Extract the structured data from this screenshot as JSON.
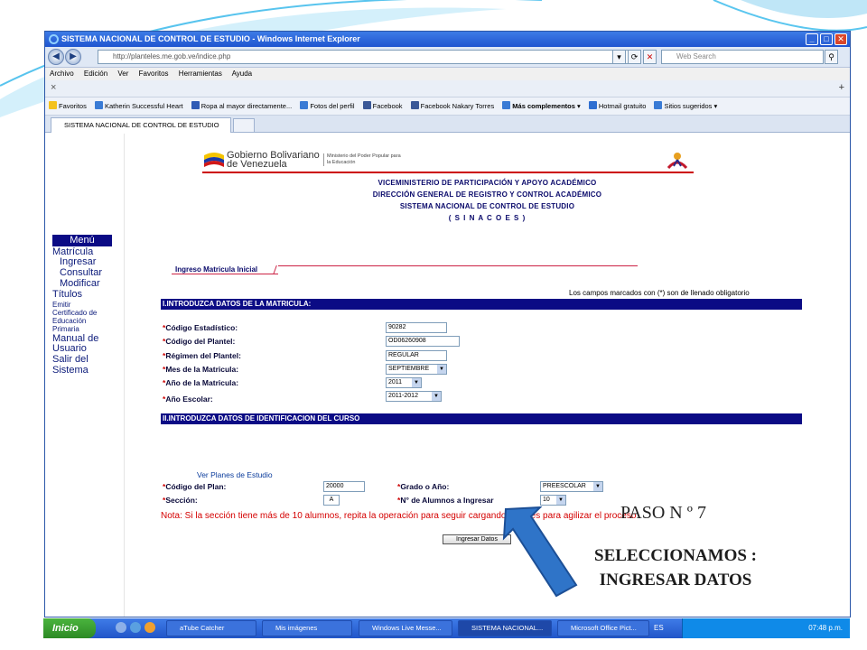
{
  "window": {
    "title": "SISTEMA NACIONAL DE CONTROL DE ESTUDIO - Windows Internet Explorer",
    "url": "http://planteles.me.gob.ve/indice.php",
    "search_placeholder": "Web Search"
  },
  "menubar": [
    "Archivo",
    "Edición",
    "Ver",
    "Favoritos",
    "Herramientas",
    "Ayuda"
  ],
  "favorites": {
    "label": "Favoritos",
    "items": [
      "Katherin Successful Heart",
      "Ropa al mayor directamente...",
      "Fotos del perfil",
      "Facebook",
      "Facebook Nakary Torres",
      "Más complementos",
      "Hotmail gratuito",
      "Sitios sugeridos"
    ]
  },
  "tab": {
    "label": "SISTEMA NACIONAL DE CONTROL DE ESTUDIO"
  },
  "logo": {
    "gobierno": "Gobierno Bolivariano",
    "venezuela": "de Venezuela",
    "ministerio": "Ministerio del Poder Popular para la Educación"
  },
  "header": {
    "line1": "VICEMINISTERIO DE PARTICIPACIÓN Y APOYO ACADÉMICO",
    "line2": "DIRECCIÓN GENERAL DE REGISTRO Y CONTROL ACADÉMICO",
    "line3": "SISTEMA NACIONAL DE CONTROL DE ESTUDIO",
    "line4": "( S I N A C O E S )"
  },
  "sidemenu": {
    "title": "Menú",
    "items": [
      "Matrícula",
      "Ingresar",
      "Consultar",
      "Modificar",
      "Títulos",
      "Emitir",
      "Certificado de",
      "Educación",
      "Primaria",
      "Manual de",
      "Usuario",
      "Salir del",
      "Sistema"
    ]
  },
  "form": {
    "section_title": "Ingreso Matricula Inicial",
    "required_note": "Los campos marcados con (*) son de llenado obligatorio",
    "section1": "I.INTRODUZCA DATOS DE LA MATRICULA:",
    "section2": "II.INTRODUZCA DATOS DE IDENTIFICACION DEL CURSO",
    "fields": {
      "codigo_estadistico": {
        "label": "Código Estadístico:",
        "value": "90282"
      },
      "codigo_plantel": {
        "label": "Código del Plantel:",
        "value": "OD06260908"
      },
      "regimen": {
        "label": "Régimen del Plantel:",
        "value": "REGULAR"
      },
      "mes": {
        "label": "Mes de la Matricula:",
        "value": "SEPTIEMBRE"
      },
      "anio": {
        "label": "Año de la Matricula:",
        "value": "2011"
      },
      "anio_escolar": {
        "label": "Año Escolar:",
        "value": "2011-2012"
      },
      "codigo_plan": {
        "label": "Código del Plan:",
        "value": "20000"
      },
      "seccion": {
        "label": "Sección:",
        "value": "A"
      },
      "grado": {
        "label": "Grado o Año:",
        "value": "PREESCOLAR"
      },
      "n_alumnos": {
        "label": "N° de Alumnos a Ingresar",
        "value": "10"
      }
    },
    "ver_planes": "Ver Planes de Estudio",
    "nota": "Nota: Si la sección tiene más de 10 alumnos, repita la operación para seguir cargando, esto es para agilizar el proceso",
    "submit": "Ingresar Datos"
  },
  "annotation": {
    "paso": "PASO N º 7",
    "line1": "SELECCIONAMOS :",
    "line2": "INGRESAR DATOS",
    "arrow_color": "#2f74c8"
  },
  "taskbar": {
    "start": "Inicio",
    "items": [
      "aTube Catcher",
      "Mis imágenes",
      "Windows Live Messe...",
      "SISTEMA NACIONAL...",
      "Microsoft Office Pict..."
    ],
    "lang": "ES",
    "clock": "07:48 p.m."
  }
}
